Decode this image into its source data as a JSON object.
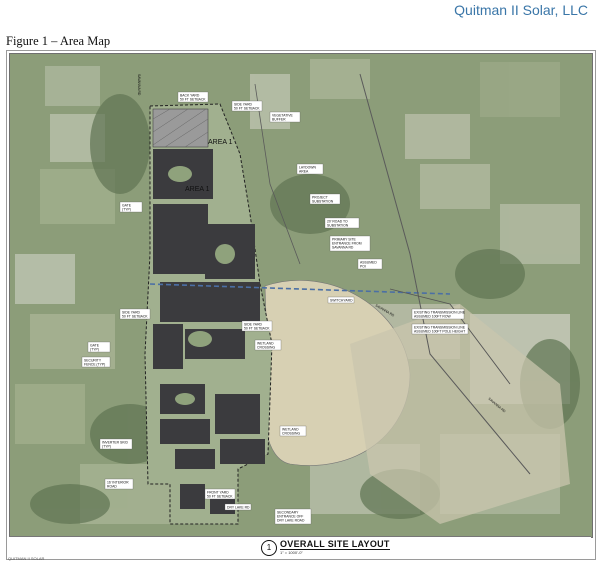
{
  "header": {
    "company": "Quitman II Solar, LLC"
  },
  "figure": {
    "title": "Figure 1 – Area Map"
  },
  "map": {
    "area_labels": [
      "AREA 1",
      "AREA 1"
    ],
    "callouts": {
      "back_yard": "BACK YARD",
      "back_yard_setback": "50 FT SETBACK",
      "side_yard": "SIDE YARD",
      "side_yard_setback": "50 FT SETBACK",
      "vegetative": "VEGETATIVE",
      "buffer": "BUFFER",
      "laydown": "LAYDOWN",
      "area": "AREA",
      "project": "PROJECT",
      "substation": "SUBSTATION",
      "road_to": "20' ROAD TO",
      "substation2": "SUBSTATION",
      "primary_site": "PRIMARY SITE",
      "entrance_from": "ENTRANCE FROM",
      "road_name": "SAVANNA RD",
      "assumed": "ASSUMED",
      "poi": "POI",
      "gate1": "GATE",
      "gate1_sub": "(TYP)",
      "side_yard2": "SIDE YARD",
      "side_yard2_setback": "50 FT SETBACK",
      "gate2": "GATE",
      "gate2_sub": "(TYP)",
      "security": "SECURITY",
      "fence": "FENCE (TYP)",
      "side_yard3": "SIDE YARD",
      "side_yard3_setback": "50 FT SETBACK",
      "wetland": "WETLAND",
      "crossing": "CROSSING",
      "wetland2": "WETLAND",
      "crossing2": "CROSSING",
      "inverter": "INVERTER SKID",
      "inverter_sub": "(TYP)",
      "interior": "16' INTERIOR",
      "road": "ROAD",
      "front_yard": "FRONT YARD",
      "front_yard_setback": "50 FT SETBACK",
      "dry_lake": "DRY LAKE RD",
      "secondary": "SECONDARY",
      "entrance_off": "ENTRANCE OFF",
      "dry_lake_road": "DRY LAKE ROAD",
      "existing_tl1": "EXISTING TRANSMISSION LINE",
      "existing_tl1_sub": "ASSUMED 100FT ROW",
      "existing_tl2": "EXISTING TRANSMISSION LINE",
      "existing_tl2_sub": "ASSUMED 100FT POLE HEIGHT",
      "switchyard": "SWITCHYARD",
      "road_side1": "SAVANNA RD",
      "road_side2": "SAVANNA RD",
      "road_top": "SAVANNA RD"
    }
  },
  "titleblock": {
    "number": "1",
    "title": "OVERALL SITE LAYOUT",
    "scale": "1\" = 1000'-0\"",
    "footnote": "QUITMAN II SOLAR"
  },
  "colors": {
    "company": "#3a76a8",
    "panels": "#3b3b3e",
    "boundary": "#2a2a2a"
  }
}
